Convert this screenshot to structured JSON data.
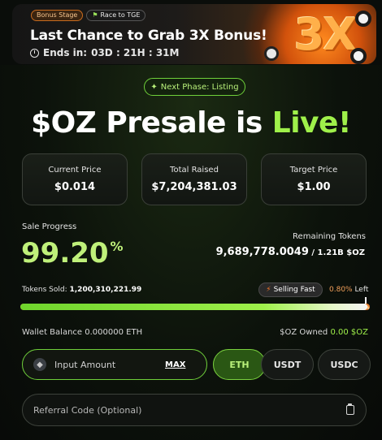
{
  "banner": {
    "tag_bonus": "Bonus Stage",
    "tag_race": "Race to TGE",
    "title": "Last Chance to Grab 3X Bonus!",
    "timer_label": "Ends in:",
    "timer_value": "03D : 21H : 31M",
    "badge": "3X"
  },
  "phase": {
    "label": "Next Phase: Listing"
  },
  "heading": {
    "prefix": "$OZ Presale is ",
    "highlight": "Live!"
  },
  "stats": [
    {
      "label": "Current Price",
      "value": "$0.014"
    },
    {
      "label": "Total Raised",
      "value": "$7,204,381.03"
    },
    {
      "label": "Target Price",
      "value": "$1.00"
    }
  ],
  "progress": {
    "label": "Sale Progress",
    "percent_text": "99.20",
    "percent_sign": "%",
    "fraction_filled": 0.992,
    "remaining_label": "Remaining Tokens",
    "remaining_value": "9,689,778.0049",
    "remaining_total": " / 1.21B $OZ",
    "tokens_sold_label": "Tokens Sold:",
    "tokens_sold_value": "1,200,310,221.99",
    "selling_fast": "Selling Fast",
    "left_pct": "0.80%",
    "left_label": " Left"
  },
  "wallet": {
    "balance_label": "Wallet Balance",
    "balance_value": "0.000000 ETH",
    "owned_label": "$OZ Owned",
    "owned_value": "0.00 $OZ"
  },
  "purchase": {
    "amount_placeholder": "Input Amount",
    "max_label": "MAX",
    "currencies": [
      "ETH",
      "USDT",
      "USDC"
    ],
    "selected_currency": "ETH",
    "referral_placeholder": "Referral Code (Optional)"
  },
  "colors": {
    "accent": "#9ff04a",
    "orange": "#e87a2a",
    "background": "#0a0d0a"
  },
  "icons": [
    "clock-icon",
    "sparkle-icon",
    "flag-icon",
    "bolt-icon",
    "eth-icon",
    "clipboard-icon"
  ]
}
